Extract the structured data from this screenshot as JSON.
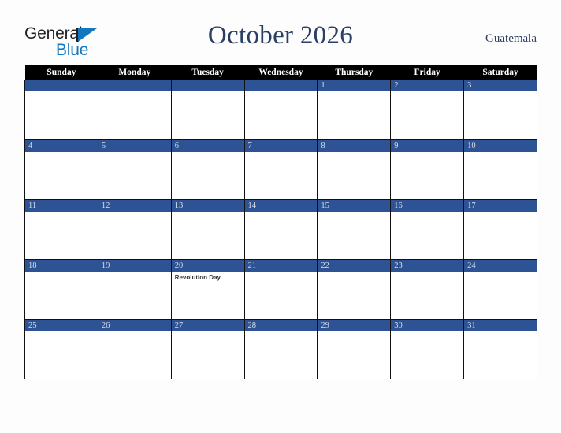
{
  "brand": {
    "name_part1": "General",
    "name_part2": "Blue",
    "triangle_color": "#1277bf",
    "text_color": "#231f20"
  },
  "header": {
    "title": "October 2026",
    "country": "Guatemala",
    "title_color": "#2a3f63"
  },
  "calendar": {
    "weekday_headers": [
      "Sunday",
      "Monday",
      "Tuesday",
      "Wednesday",
      "Thursday",
      "Friday",
      "Saturday"
    ],
    "header_bg": "#000000",
    "header_text_color": "#ffffff",
    "daynum_bg": "#2e5394",
    "daynum_text_color": "#d9dde6",
    "cell_bg": "#ffffff",
    "border_color": "#111111",
    "month": "October",
    "year": "2026",
    "weeks": [
      [
        {
          "day": "",
          "events": []
        },
        {
          "day": "",
          "events": []
        },
        {
          "day": "",
          "events": []
        },
        {
          "day": "",
          "events": []
        },
        {
          "day": "1",
          "events": []
        },
        {
          "day": "2",
          "events": []
        },
        {
          "day": "3",
          "events": []
        }
      ],
      [
        {
          "day": "4",
          "events": []
        },
        {
          "day": "5",
          "events": []
        },
        {
          "day": "6",
          "events": []
        },
        {
          "day": "7",
          "events": []
        },
        {
          "day": "8",
          "events": []
        },
        {
          "day": "9",
          "events": []
        },
        {
          "day": "10",
          "events": []
        }
      ],
      [
        {
          "day": "11",
          "events": []
        },
        {
          "day": "12",
          "events": []
        },
        {
          "day": "13",
          "events": []
        },
        {
          "day": "14",
          "events": []
        },
        {
          "day": "15",
          "events": []
        },
        {
          "day": "16",
          "events": []
        },
        {
          "day": "17",
          "events": []
        }
      ],
      [
        {
          "day": "18",
          "events": []
        },
        {
          "day": "19",
          "events": []
        },
        {
          "day": "20",
          "events": [
            "Revolution Day"
          ]
        },
        {
          "day": "21",
          "events": []
        },
        {
          "day": "22",
          "events": []
        },
        {
          "day": "23",
          "events": []
        },
        {
          "day": "24",
          "events": []
        }
      ],
      [
        {
          "day": "25",
          "events": []
        },
        {
          "day": "26",
          "events": []
        },
        {
          "day": "27",
          "events": []
        },
        {
          "day": "28",
          "events": []
        },
        {
          "day": "29",
          "events": []
        },
        {
          "day": "30",
          "events": []
        },
        {
          "day": "31",
          "events": []
        }
      ]
    ]
  }
}
